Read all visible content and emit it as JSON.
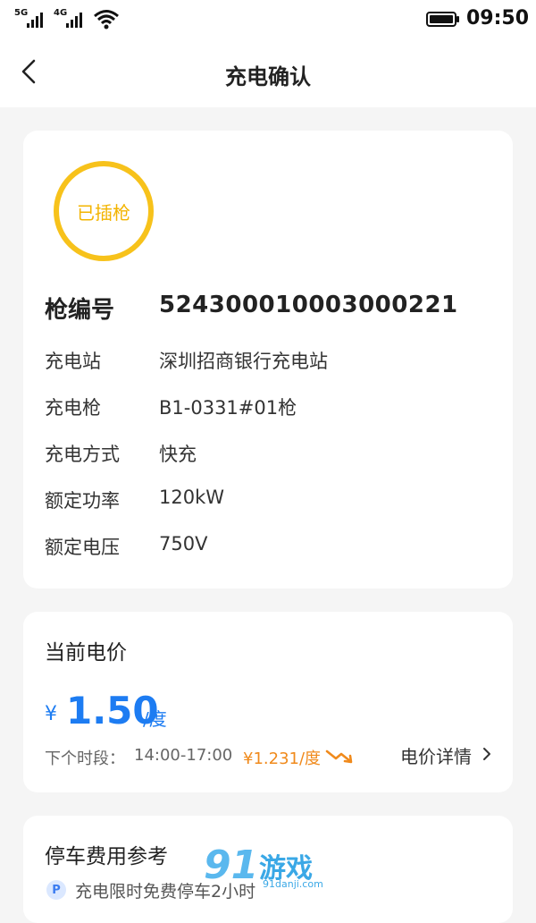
{
  "status_bar": {
    "signal1": "5G",
    "signal2": "4G",
    "time": "09:50",
    "battery_level": 1.0
  },
  "nav": {
    "title": "充电确认"
  },
  "charger": {
    "status": "已插枪",
    "gun_number_label": "枪编号",
    "gun_number": "524300010003000221",
    "rows": [
      {
        "label": "充电站",
        "value": "深圳招商银行充电站"
      },
      {
        "label": "充电枪",
        "value": "B1-0331#01枪"
      },
      {
        "label": "充电方式",
        "value": "快充"
      },
      {
        "label": "额定功率",
        "value": "120kW"
      },
      {
        "label": "额定电压",
        "value": "750V"
      }
    ]
  },
  "price": {
    "title": "当前电价",
    "currency": "¥",
    "value": "1.50",
    "unit": "/度",
    "next_label": "下个时段：",
    "next_time": "14:00-17:00",
    "next_price": "¥1.231/度",
    "detail_link": "电价详情"
  },
  "parking": {
    "title": "停车费用参考",
    "icon_letter": "P",
    "note": "充电限时免费停车2小时"
  },
  "watermark": {
    "number": "91",
    "text": "游戏",
    "sub": "91danji.com"
  },
  "colors": {
    "accent_blue": "#1d7cf2",
    "status_yellow": "#f7c21b",
    "next_price_orange": "#f08a1c"
  }
}
